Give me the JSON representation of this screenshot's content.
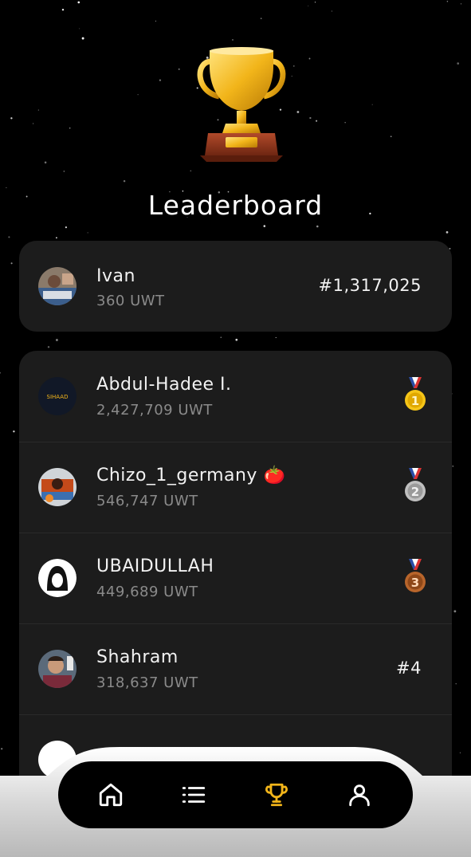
{
  "header": {
    "title": "Leaderboard"
  },
  "current_user": {
    "name": "Ivan",
    "score": "360 UWT",
    "rank": "#1,317,025"
  },
  "leaderboard": [
    {
      "name": "Abdul-Hadee I.",
      "score": "2,427,709 UWT",
      "rank": "1",
      "medal": "gold"
    },
    {
      "name": "Chizo_1_germany 🍅",
      "score": "546,747 UWT",
      "rank": "2",
      "medal": "silver"
    },
    {
      "name": "UBAIDULLAH",
      "score": "449,689 UWT",
      "rank": "3",
      "medal": "bronze"
    },
    {
      "name": "Shahram",
      "score": "318,637 UWT",
      "rank": "#4"
    }
  ],
  "avatar_logo_text": "SIHAAD",
  "nav": {
    "items": [
      "home-icon",
      "list-icon",
      "trophy-icon",
      "profile-icon"
    ],
    "active": "trophy-icon"
  },
  "colors": {
    "background": "#000000",
    "card": "#1c1c1c",
    "accent": "#f2b51a",
    "muted_text": "#8a8a8a",
    "gold": "#f5c518",
    "silver": "#c0c0c0",
    "bronze": "#b8652b"
  }
}
